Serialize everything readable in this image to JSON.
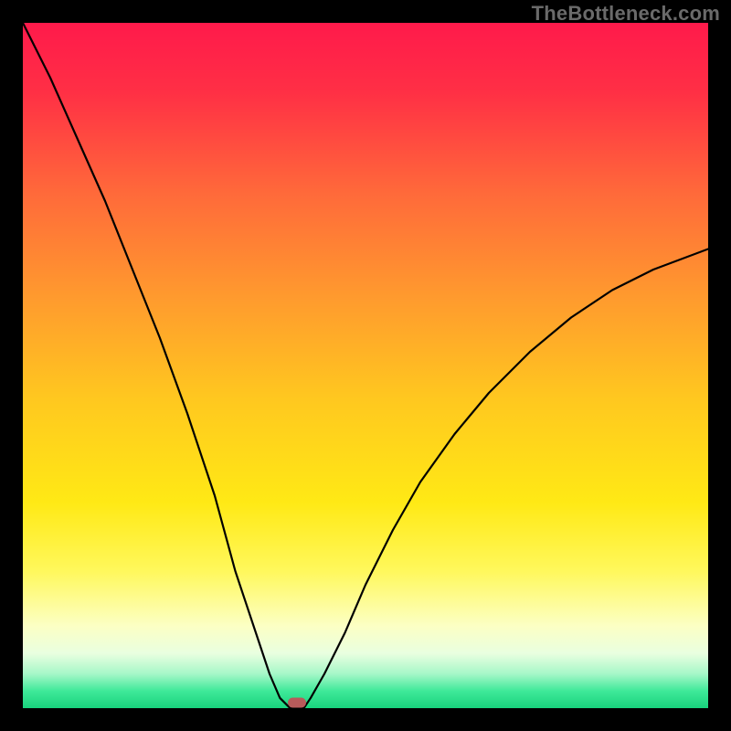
{
  "watermark": "TheBottleneck.com",
  "chart_data": {
    "type": "line",
    "title": "",
    "xlabel": "",
    "ylabel": "",
    "xlim": [
      0,
      100
    ],
    "ylim": [
      0,
      100
    ],
    "grid": false,
    "background_gradient": {
      "stops": [
        {
          "offset": 0.0,
          "color": "#ff1a4b"
        },
        {
          "offset": 0.1,
          "color": "#ff2f45"
        },
        {
          "offset": 0.25,
          "color": "#ff6a3a"
        },
        {
          "offset": 0.4,
          "color": "#ff9a2e"
        },
        {
          "offset": 0.55,
          "color": "#ffc81f"
        },
        {
          "offset": 0.7,
          "color": "#ffe915"
        },
        {
          "offset": 0.8,
          "color": "#fff85c"
        },
        {
          "offset": 0.88,
          "color": "#fcffc4"
        },
        {
          "offset": 0.92,
          "color": "#e9ffe0"
        },
        {
          "offset": 0.95,
          "color": "#a6f7c8"
        },
        {
          "offset": 0.975,
          "color": "#3fe999"
        },
        {
          "offset": 1.0,
          "color": "#18d37d"
        }
      ]
    },
    "series": [
      {
        "name": "bottleneck-curve",
        "x": [
          0,
          4,
          8,
          12,
          16,
          20,
          24,
          28,
          31,
          34,
          36,
          37.5,
          39,
          40,
          41,
          42,
          44,
          47,
          50,
          54,
          58,
          63,
          68,
          74,
          80,
          86,
          92,
          100
        ],
        "y": [
          100,
          92,
          83,
          74,
          64,
          54,
          43,
          31,
          20,
          11,
          5,
          1.5,
          0,
          0,
          0,
          1.5,
          5,
          11,
          18,
          26,
          33,
          40,
          46,
          52,
          57,
          61,
          64,
          67
        ]
      }
    ],
    "marker": {
      "x": 40,
      "y": 0.8,
      "color": "#b85a5a"
    }
  }
}
